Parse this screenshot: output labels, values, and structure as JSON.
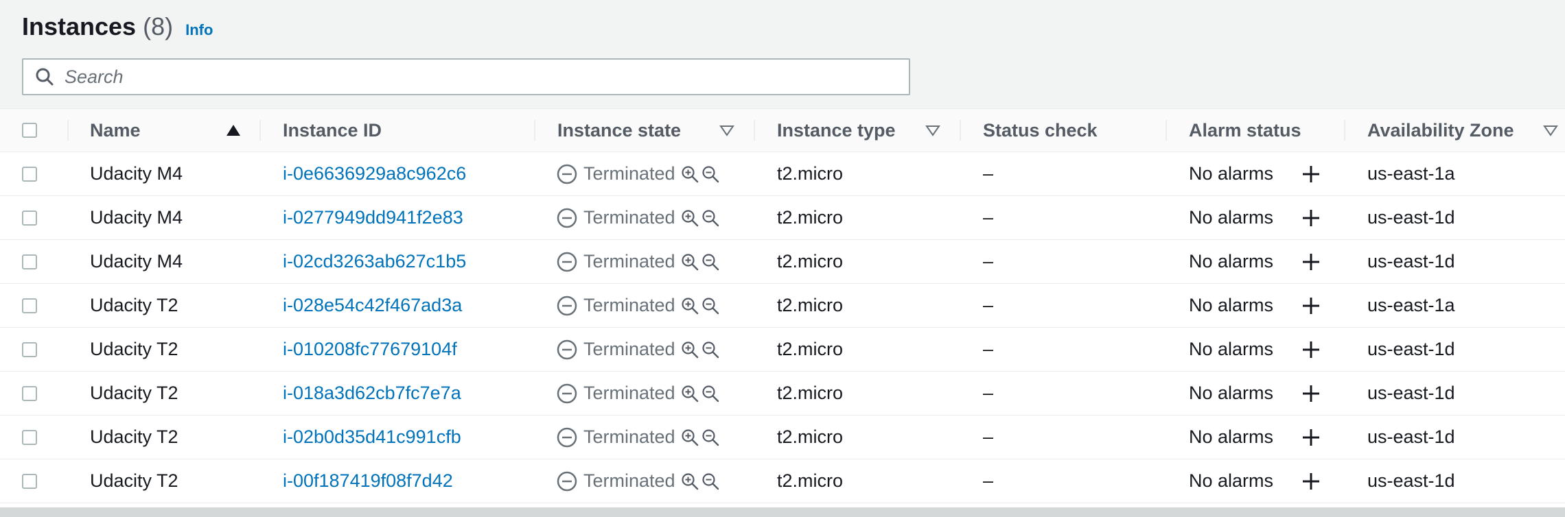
{
  "header": {
    "title": "Instances",
    "count": "(8)",
    "info": "Info"
  },
  "search": {
    "placeholder": "Search"
  },
  "columns": {
    "name": "Name",
    "instance_id": "Instance ID",
    "instance_state": "Instance state",
    "instance_type": "Instance type",
    "status_check": "Status check",
    "alarm_status": "Alarm status",
    "availability_zone": "Availability Zone"
  },
  "rows": [
    {
      "name": "Udacity M4",
      "instance_id": "i-0e6636929a8c962c6",
      "state": "Terminated",
      "type": "t2.micro",
      "status_check": "–",
      "alarm": "No alarms",
      "az": "us-east-1a"
    },
    {
      "name": "Udacity M4",
      "instance_id": "i-0277949dd941f2e83",
      "state": "Terminated",
      "type": "t2.micro",
      "status_check": "–",
      "alarm": "No alarms",
      "az": "us-east-1d"
    },
    {
      "name": "Udacity M4",
      "instance_id": "i-02cd3263ab627c1b5",
      "state": "Terminated",
      "type": "t2.micro",
      "status_check": "–",
      "alarm": "No alarms",
      "az": "us-east-1d"
    },
    {
      "name": "Udacity T2",
      "instance_id": "i-028e54c42f467ad3a",
      "state": "Terminated",
      "type": "t2.micro",
      "status_check": "–",
      "alarm": "No alarms",
      "az": "us-east-1a"
    },
    {
      "name": "Udacity T2",
      "instance_id": "i-010208fc77679104f",
      "state": "Terminated",
      "type": "t2.micro",
      "status_check": "–",
      "alarm": "No alarms",
      "az": "us-east-1d"
    },
    {
      "name": "Udacity T2",
      "instance_id": "i-018a3d62cb7fc7e7a",
      "state": "Terminated",
      "type": "t2.micro",
      "status_check": "–",
      "alarm": "No alarms",
      "az": "us-east-1d"
    },
    {
      "name": "Udacity T2",
      "instance_id": "i-02b0d35d41c991cfb",
      "state": "Terminated",
      "type": "t2.micro",
      "status_check": "–",
      "alarm": "No alarms",
      "az": "us-east-1d"
    },
    {
      "name": "Udacity T2",
      "instance_id": "i-00f187419f08f7d42",
      "state": "Terminated",
      "type": "t2.micro",
      "status_check": "–",
      "alarm": "No alarms",
      "az": "us-east-1d"
    }
  ],
  "icons": {
    "search": "search-icon",
    "sort_asc": "sort-ascending-icon",
    "filter": "filter-triangle-icon",
    "terminated": "minus-circle-icon",
    "zoom_in": "zoom-in-icon",
    "zoom_out": "zoom-out-icon",
    "add_alarm": "plus-icon"
  },
  "colors": {
    "link": "#0073bb",
    "header_bg": "#f2f3f3",
    "muted_text": "#687078",
    "border": "#aab7b8"
  }
}
